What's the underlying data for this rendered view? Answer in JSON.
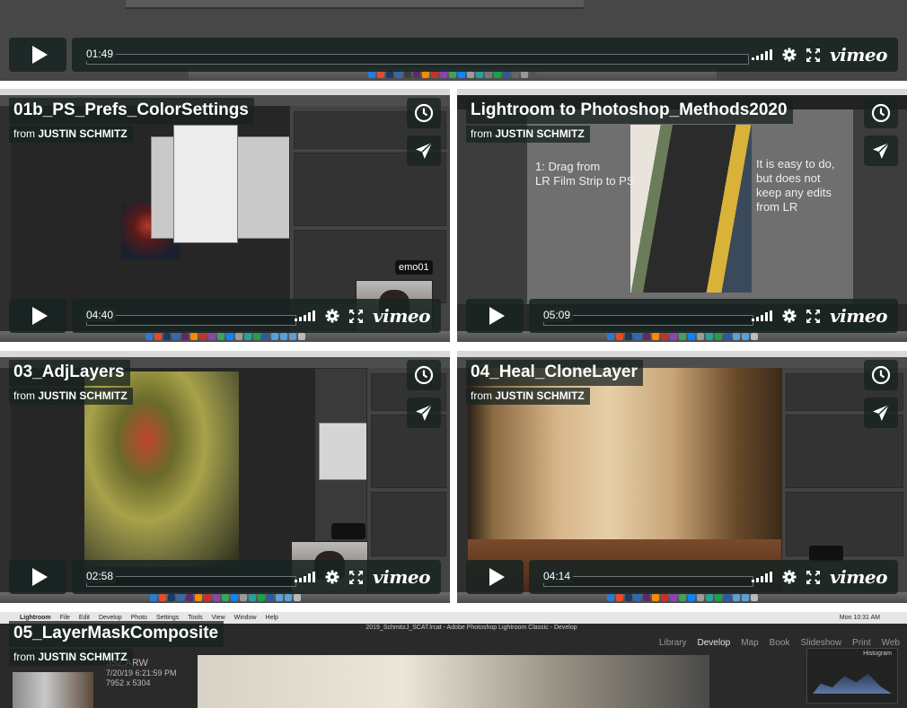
{
  "common": {
    "author_prefix": "from",
    "author": "JUSTIN SCHMITZ",
    "brand": "vimeo"
  },
  "videos": [
    {
      "title": "",
      "duration": "01:49"
    },
    {
      "title": "01b_PS_Prefs_ColorSettings",
      "duration": "04:40",
      "webcam_label": "emo01"
    },
    {
      "title": "Lightroom to Photoshop_Methods2020",
      "duration": "05:09",
      "slide_left": "1: Drag from\nLR Film Strip to PS",
      "slide_right": "It is easy to do,\nbut does not\nkeep any edits\nfrom LR"
    },
    {
      "title": "03_AdjLayers",
      "duration": "02:58"
    },
    {
      "title": "04_Heal_CloneLayer",
      "duration": "04:14"
    },
    {
      "title": "05_LayerMaskComposite",
      "lr_menu": [
        "Lightroom",
        "File",
        "Edit",
        "Develop",
        "Photo",
        "Settings",
        "Tools",
        "View",
        "Window",
        "Help"
      ],
      "lr_window_title": "2019_SchmitzJ_SCAT.lrcat - Adobe Photoshop Lightroom Classic - Develop",
      "lr_modules": [
        "Library",
        "Develop",
        "Map",
        "Book",
        "Slideshow",
        "Print",
        "Web"
      ],
      "lr_clock": "Mon 10:31 AM",
      "file_name": "352.ARW",
      "file_date": "7/20/19 6:21:59 PM",
      "file_dims": "7952 x 5304",
      "histogram_label": "Histogram"
    }
  ],
  "colors": {
    "overlay": "#172322",
    "accent": "#ffffff"
  }
}
